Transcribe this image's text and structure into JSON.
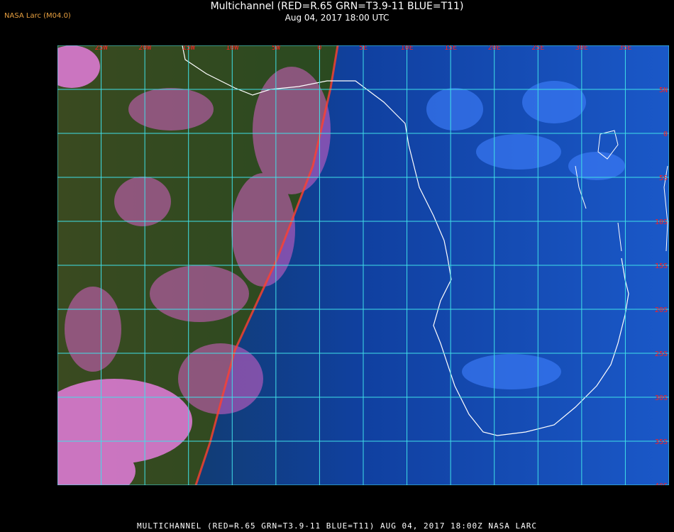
{
  "header": {
    "brand": "NASA Larc (M04.0)",
    "title": "Multichannel (RED=R.65 GRN=T3.9-11 BLUE=T11)",
    "subtitle": "Aug 04, 2017 18:00 UTC"
  },
  "footer": {
    "text": "MULTICHANNEL  (RED=R.65 GRN=T3.9-11 BLUE=T11) AUG 04, 2017 18:00Z   NASA LARC"
  },
  "map": {
    "lon_labels": [
      "25W",
      "20W",
      "15W",
      "10W",
      "5W",
      "0",
      "5E",
      "10E",
      "15E",
      "20E",
      "25E",
      "30E",
      "35E"
    ],
    "lat_labels": [
      "5N",
      "0",
      "5S",
      "10S",
      "15S",
      "20S",
      "25S",
      "30S",
      "35S",
      "40S"
    ],
    "colors": {
      "grid": "#40e0e8",
      "label": "#ff2020",
      "coast": "#ffffff",
      "pink_cloud": "#e070d8",
      "ocean_dark": "#1a3a1a",
      "land_blue": "#1040a0"
    }
  }
}
